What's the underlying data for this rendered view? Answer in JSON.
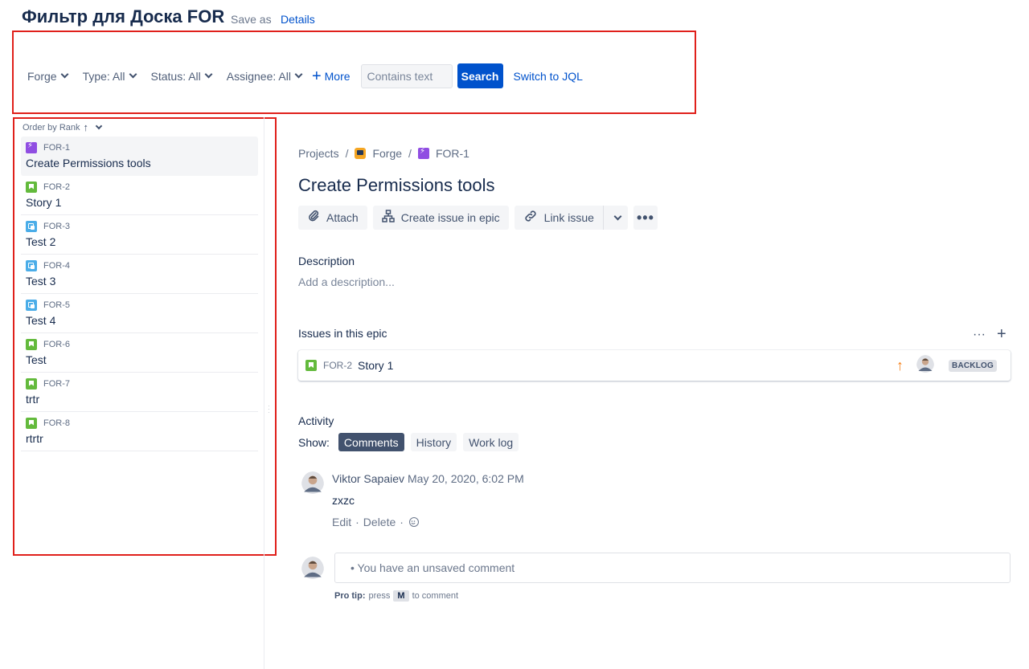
{
  "header": {
    "title": "Фильтр для Доска FOR",
    "save_as": "Save as",
    "details": "Details"
  },
  "filters": {
    "project": "Forge",
    "type": "Type: All",
    "status": "Status: All",
    "assignee": "Assignee: All",
    "more": "More",
    "search_placeholder": "Contains text",
    "search_button": "Search",
    "switch_jql": "Switch to JQL"
  },
  "list": {
    "order_by": "Order by Rank",
    "items": [
      {
        "key": "FOR-1",
        "summary": "Create Permissions tools",
        "type": "epic"
      },
      {
        "key": "FOR-2",
        "summary": "Story 1",
        "type": "story"
      },
      {
        "key": "FOR-3",
        "summary": "Test 2",
        "type": "test"
      },
      {
        "key": "FOR-4",
        "summary": "Test 3",
        "type": "test"
      },
      {
        "key": "FOR-5",
        "summary": "Test 4",
        "type": "test"
      },
      {
        "key": "FOR-6",
        "summary": "Test",
        "type": "story"
      },
      {
        "key": "FOR-7",
        "summary": "trtr",
        "type": "story"
      },
      {
        "key": "FOR-8",
        "summary": "rtrtr",
        "type": "story"
      }
    ]
  },
  "detail": {
    "breadcrumb": {
      "projects": "Projects",
      "project": "Forge",
      "issue": "FOR-1"
    },
    "title": "Create Permissions tools",
    "toolbar": {
      "attach": "Attach",
      "create_in_epic": "Create issue in epic",
      "link_issue": "Link issue"
    },
    "description_label": "Description",
    "description_placeholder": "Add a description...",
    "epic_section_label": "Issues in this epic",
    "child_issue": {
      "key": "FOR-2",
      "summary": "Story 1",
      "status": "BACKLOG"
    },
    "activity_label": "Activity",
    "show_label": "Show:",
    "tabs": {
      "comments": "Comments",
      "history": "History",
      "worklog": "Work log"
    },
    "comment": {
      "author": "Viktor Sapaiev",
      "time": "May 20, 2020, 6:02 PM",
      "body": "zxzc",
      "edit": "Edit",
      "delete": "Delete"
    },
    "new_comment_placeholder": "• You have an unsaved comment",
    "protip": {
      "label": "Pro tip:",
      "press": "press",
      "key": "M",
      "suffix": "to comment"
    }
  },
  "colors": {
    "primary": "#0052cc",
    "highlight": "#e0201b",
    "epic": "#904ee2",
    "story": "#63ba3c",
    "test": "#4bade8"
  }
}
